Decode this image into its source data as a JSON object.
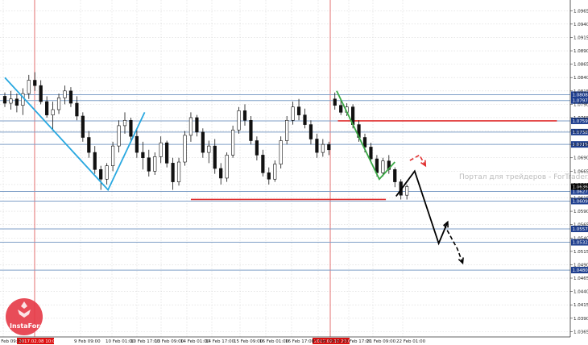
{
  "watermark": "Портал для трейдеров - ForTrader.org",
  "logo": {
    "name": "InstaForex",
    "color": "#e63946"
  },
  "colors": {
    "grid": "#d9d9d9",
    "level": "#7f9fc7",
    "candle": "#111111",
    "vline": "#e06060",
    "redLevel": "#e03030",
    "blueWave": "#29a8e0",
    "greenWave": "#3aa845",
    "tag": "#1f3f8f",
    "currentTag": "#000000"
  },
  "chart_data": {
    "type": "candlestick",
    "symbol_timeframe": "H1",
    "ylim": [
      1.0355,
      1.0985
    ],
    "y_ticks": [
      "1.0965",
      "1.0940",
      "1.0915",
      "1.0890",
      "1.0865",
      "1.0840",
      "1.0815",
      "1.0790",
      "1.0765",
      "1.0740",
      "1.0715",
      "1.0690",
      "1.0665",
      "1.0640",
      "1.0615",
      "1.0590",
      "1.0565",
      "1.0540",
      "1.0515",
      "1.0490",
      "1.0465",
      "1.0440",
      "1.0415",
      "1.0390",
      "1.0365"
    ],
    "x_ticks": [
      "8 Feb 09:00",
      "9 Feb 09:00",
      "10 Feb 01:00",
      "10 Feb 17:00",
      "13 Feb 09:00",
      "14 Feb 01:00",
      "14 Feb 17:00",
      "15 Feb 09:00",
      "16 Feb 01:00",
      "16 Feb 17:00",
      "17 Feb 09:00",
      "20 Feb 17:00",
      "21 Feb 09:00",
      "22 Feb 01:00"
    ],
    "highlighted_times": [
      "2017.02.08 10:00",
      "2017.02.17 23:00"
    ],
    "current_price": "1.0636",
    "levels": [
      {
        "price": 1.0808,
        "label": "1.0808"
      },
      {
        "price": 1.0797,
        "label": "1.0797"
      },
      {
        "price": 1.0759,
        "label": "1.0759"
      },
      {
        "price": 1.0738,
        "label": "1.0738"
      },
      {
        "price": 1.0715,
        "label": "1.0715"
      },
      {
        "price": 1.0627,
        "label": "1.0627"
      },
      {
        "price": 1.0609,
        "label": "1.0609"
      },
      {
        "price": 1.0557,
        "label": "1.0557"
      },
      {
        "price": 1.0532,
        "label": "1.0532"
      },
      {
        "price": 1.048,
        "label": "1.0480"
      }
    ],
    "red_levels": [
      {
        "price": 1.0759,
        "from_index": 55.5,
        "to_index": 92
      },
      {
        "price": 1.0612,
        "from_index": 31,
        "to_index": 63.5
      }
    ],
    "candles": [
      {
        "o": 1.0805,
        "h": 1.0812,
        "l": 1.0785,
        "c": 1.0792
      },
      {
        "o": 1.0792,
        "h": 1.0815,
        "l": 1.078,
        "c": 1.08
      },
      {
        "o": 1.08,
        "h": 1.081,
        "l": 1.0775,
        "c": 1.0788
      },
      {
        "o": 1.0788,
        "h": 1.082,
        "l": 1.077,
        "c": 1.081
      },
      {
        "o": 1.081,
        "h": 1.0845,
        "l": 1.08,
        "c": 1.0835
      },
      {
        "o": 1.0835,
        "h": 1.085,
        "l": 1.0815,
        "c": 1.0825
      },
      {
        "o": 1.0825,
        "h": 1.0835,
        "l": 1.079,
        "c": 1.0795
      },
      {
        "o": 1.0795,
        "h": 1.0805,
        "l": 1.0765,
        "c": 1.077
      },
      {
        "o": 1.077,
        "h": 1.0795,
        "l": 1.074,
        "c": 1.078
      },
      {
        "o": 1.078,
        "h": 1.081,
        "l": 1.0772,
        "c": 1.0802
      },
      {
        "o": 1.0802,
        "h": 1.0825,
        "l": 1.079,
        "c": 1.0815
      },
      {
        "o": 1.0815,
        "h": 1.0822,
        "l": 1.0785,
        "c": 1.0792
      },
      {
        "o": 1.0792,
        "h": 1.0805,
        "l": 1.076,
        "c": 1.0768
      },
      {
        "o": 1.0768,
        "h": 1.0775,
        "l": 1.072,
        "c": 1.0728
      },
      {
        "o": 1.0728,
        "h": 1.074,
        "l": 1.069,
        "c": 1.07
      },
      {
        "o": 1.07,
        "h": 1.0712,
        "l": 1.066,
        "c": 1.0668
      },
      {
        "o": 1.0668,
        "h": 1.0675,
        "l": 1.063,
        "c": 1.065
      },
      {
        "o": 1.065,
        "h": 1.068,
        "l": 1.064,
        "c": 1.0675
      },
      {
        "o": 1.0675,
        "h": 1.072,
        "l": 1.0665,
        "c": 1.0712
      },
      {
        "o": 1.0712,
        "h": 1.076,
        "l": 1.07,
        "c": 1.075
      },
      {
        "o": 1.075,
        "h": 1.0775,
        "l": 1.0735,
        "c": 1.076
      },
      {
        "o": 1.076,
        "h": 1.0765,
        "l": 1.072,
        "c": 1.073
      },
      {
        "o": 1.073,
        "h": 1.0742,
        "l": 1.069,
        "c": 1.07
      },
      {
        "o": 1.07,
        "h": 1.072,
        "l": 1.0668,
        "c": 1.069
      },
      {
        "o": 1.069,
        "h": 1.0705,
        "l": 1.0655,
        "c": 1.0665
      },
      {
        "o": 1.0665,
        "h": 1.07,
        "l": 1.0658,
        "c": 1.0692
      },
      {
        "o": 1.0692,
        "h": 1.073,
        "l": 1.068,
        "c": 1.0718
      },
      {
        "o": 1.0718,
        "h": 1.0722,
        "l": 1.0672,
        "c": 1.068
      },
      {
        "o": 1.068,
        "h": 1.069,
        "l": 1.063,
        "c": 1.0645
      },
      {
        "o": 1.0645,
        "h": 1.069,
        "l": 1.0638,
        "c": 1.0682
      },
      {
        "o": 1.0682,
        "h": 1.074,
        "l": 1.0675,
        "c": 1.0732
      },
      {
        "o": 1.0732,
        "h": 1.0775,
        "l": 1.072,
        "c": 1.0765
      },
      {
        "o": 1.0765,
        "h": 1.077,
        "l": 1.073,
        "c": 1.0738
      },
      {
        "o": 1.0738,
        "h": 1.0745,
        "l": 1.069,
        "c": 1.07
      },
      {
        "o": 1.07,
        "h": 1.0722,
        "l": 1.068,
        "c": 1.0712
      },
      {
        "o": 1.0712,
        "h": 1.0725,
        "l": 1.066,
        "c": 1.067
      },
      {
        "o": 1.067,
        "h": 1.068,
        "l": 1.064,
        "c": 1.0652
      },
      {
        "o": 1.0652,
        "h": 1.07,
        "l": 1.0645,
        "c": 1.0695
      },
      {
        "o": 1.0695,
        "h": 1.075,
        "l": 1.069,
        "c": 1.0742
      },
      {
        "o": 1.0742,
        "h": 1.0785,
        "l": 1.0735,
        "c": 1.0778
      },
      {
        "o": 1.0778,
        "h": 1.079,
        "l": 1.075,
        "c": 1.076
      },
      {
        "o": 1.076,
        "h": 1.0768,
        "l": 1.0715,
        "c": 1.0722
      },
      {
        "o": 1.0722,
        "h": 1.073,
        "l": 1.0685,
        "c": 1.0695
      },
      {
        "o": 1.0695,
        "h": 1.0705,
        "l": 1.0655,
        "c": 1.0662
      },
      {
        "o": 1.0662,
        "h": 1.0672,
        "l": 1.064,
        "c": 1.065
      },
      {
        "o": 1.065,
        "h": 1.0685,
        "l": 1.0645,
        "c": 1.0678
      },
      {
        "o": 1.0678,
        "h": 1.073,
        "l": 1.067,
        "c": 1.0722
      },
      {
        "o": 1.0722,
        "h": 1.0768,
        "l": 1.0715,
        "c": 1.076
      },
      {
        "o": 1.076,
        "h": 1.0795,
        "l": 1.0752,
        "c": 1.0785
      },
      {
        "o": 1.0785,
        "h": 1.08,
        "l": 1.076,
        "c": 1.077
      },
      {
        "o": 1.077,
        "h": 1.0782,
        "l": 1.0745,
        "c": 1.0752
      },
      {
        "o": 1.0752,
        "h": 1.076,
        "l": 1.0715,
        "c": 1.0725
      },
      {
        "o": 1.0725,
        "h": 1.0735,
        "l": 1.069,
        "c": 1.07
      },
      {
        "o": 1.07,
        "h": 1.0725,
        "l": 1.0692,
        "c": 1.0715
      },
      {
        "o": 1.0715,
        "h": 1.072,
        "l": 1.0695,
        "c": 1.0705
      },
      {
        "o": 1.08,
        "h": 1.0812,
        "l": 1.078,
        "c": 1.0788
      },
      {
        "o": 1.0788,
        "h": 1.0798,
        "l": 1.077,
        "c": 1.0775
      },
      {
        "o": 1.0775,
        "h": 1.0792,
        "l": 1.0768,
        "c": 1.0785
      },
      {
        "o": 1.0785,
        "h": 1.079,
        "l": 1.0745,
        "c": 1.0752
      },
      {
        "o": 1.0752,
        "h": 1.076,
        "l": 1.072,
        "c": 1.0728
      },
      {
        "o": 1.0728,
        "h": 1.0735,
        "l": 1.07,
        "c": 1.071
      },
      {
        "o": 1.071,
        "h": 1.0718,
        "l": 1.068,
        "c": 1.0688
      },
      {
        "o": 1.0688,
        "h": 1.0695,
        "l": 1.0655,
        "c": 1.0662
      },
      {
        "o": 1.0662,
        "h": 1.069,
        "l": 1.0655,
        "c": 1.0684
      },
      {
        "o": 1.0684,
        "h": 1.0695,
        "l": 1.066,
        "c": 1.0668
      },
      {
        "o": 1.0668,
        "h": 1.0672,
        "l": 1.0635,
        "c": 1.0645
      },
      {
        "o": 1.0645,
        "h": 1.065,
        "l": 1.0612,
        "c": 1.062
      },
      {
        "o": 1.062,
        "h": 1.064,
        "l": 1.0612,
        "c": 1.0636
      }
    ],
    "blue_wave": [
      [
        0,
        1.084
      ],
      [
        17.2,
        1.063
      ],
      [
        23.3,
        1.0775
      ]
    ],
    "green_wave": [
      [
        55.3,
        1.0815
      ],
      [
        62.4,
        1.065
      ],
      [
        65,
        1.0682
      ]
    ],
    "forecast_black": [
      [
        65.2,
        1.0618
      ],
      [
        68.3,
        1.0665
      ],
      [
        72.3,
        1.053
      ],
      [
        73.8,
        1.057
      ]
    ],
    "forecast_black_dashed": [
      [
        73.2,
        1.0565
      ],
      [
        75.4,
        1.052
      ],
      [
        76.3,
        1.0493
      ],
      [
        77,
        1.0495
      ]
    ],
    "forecast_red_dashed": [
      [
        67.5,
        1.0685
      ],
      [
        69.1,
        1.0695
      ],
      [
        70.1,
        1.0675
      ],
      [
        69.8,
        1.0682
      ]
    ]
  }
}
